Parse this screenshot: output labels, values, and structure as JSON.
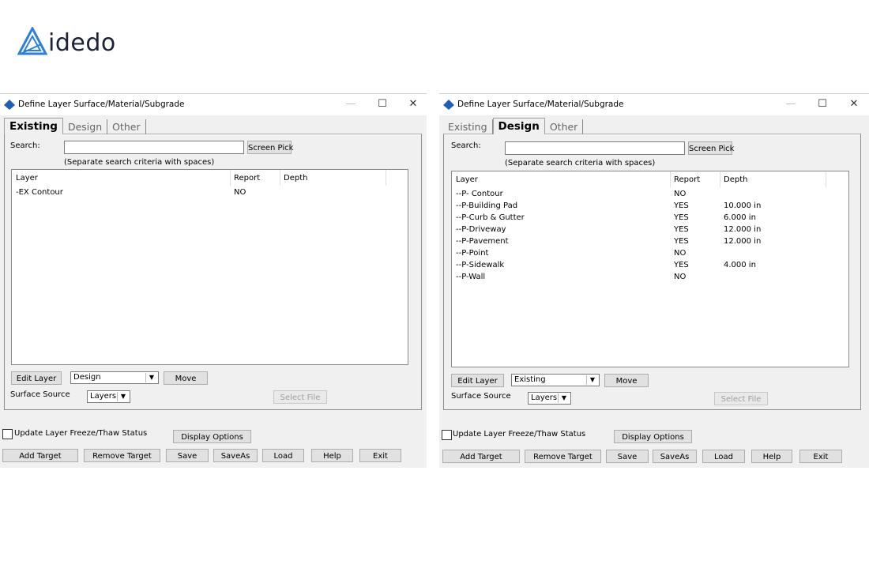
{
  "logo": {
    "text": "idedo"
  },
  "windows": [
    {
      "title": "Define Layer Surface/Material/Subgrade",
      "tabs": [
        {
          "label": "Existing",
          "active": true
        },
        {
          "label": "Design",
          "active": false
        },
        {
          "label": "Other",
          "active": false
        }
      ],
      "search": {
        "label": "Search:",
        "value": "",
        "hint": "(Separate search criteria with spaces)",
        "screen_pick": "Screen Pick"
      },
      "columns": [
        "Layer",
        "Report",
        "Depth"
      ],
      "rows": [
        {
          "layer": "-EX Contour",
          "report": "NO",
          "depth": ""
        }
      ],
      "edit_layer": "Edit Layer",
      "move_target": "Design",
      "move": "Move",
      "surface_source_label": "Surface Source",
      "surface_source_value": "Layers",
      "select_file": "Select File",
      "update_check": "Update Layer Freeze/Thaw Status",
      "display_options": "Display Options",
      "bottom_buttons": [
        "Add Target",
        "Remove Target",
        "Save",
        "SaveAs",
        "Load",
        "Help",
        "Exit"
      ]
    },
    {
      "title": "Define Layer Surface/Material/Subgrade",
      "tabs": [
        {
          "label": "Existing",
          "active": false
        },
        {
          "label": "Design",
          "active": true
        },
        {
          "label": "Other",
          "active": false
        }
      ],
      "search": {
        "label": "Search:",
        "value": "",
        "hint": "(Separate search criteria with spaces)",
        "screen_pick": "Screen Pick"
      },
      "columns": [
        "Layer",
        "Report",
        "Depth"
      ],
      "rows": [
        {
          "layer": "--P- Contour",
          "report": "NO",
          "depth": ""
        },
        {
          "layer": "--P-Building Pad",
          "report": "YES",
          "depth": "10.000 in"
        },
        {
          "layer": "--P-Curb & Gutter",
          "report": "YES",
          "depth": "6.000 in"
        },
        {
          "layer": "--P-Driveway",
          "report": "YES",
          "depth": "12.000 in"
        },
        {
          "layer": "--P-Pavement",
          "report": "YES",
          "depth": "12.000 in"
        },
        {
          "layer": "--P-Point",
          "report": "NO",
          "depth": ""
        },
        {
          "layer": "--P-Sidewalk",
          "report": "YES",
          "depth": "4.000 in"
        },
        {
          "layer": "--P-Wall",
          "report": "NO",
          "depth": ""
        }
      ],
      "edit_layer": "Edit Layer",
      "move_target": "Existing",
      "move": "Move",
      "surface_source_label": "Surface Source",
      "surface_source_value": "Layers",
      "select_file": "Select File",
      "update_check": "Update Layer Freeze/Thaw Status",
      "display_options": "Display Options",
      "bottom_buttons": [
        "Add Target",
        "Remove Target",
        "Save",
        "SaveAs",
        "Load",
        "Help",
        "Exit"
      ]
    }
  ]
}
